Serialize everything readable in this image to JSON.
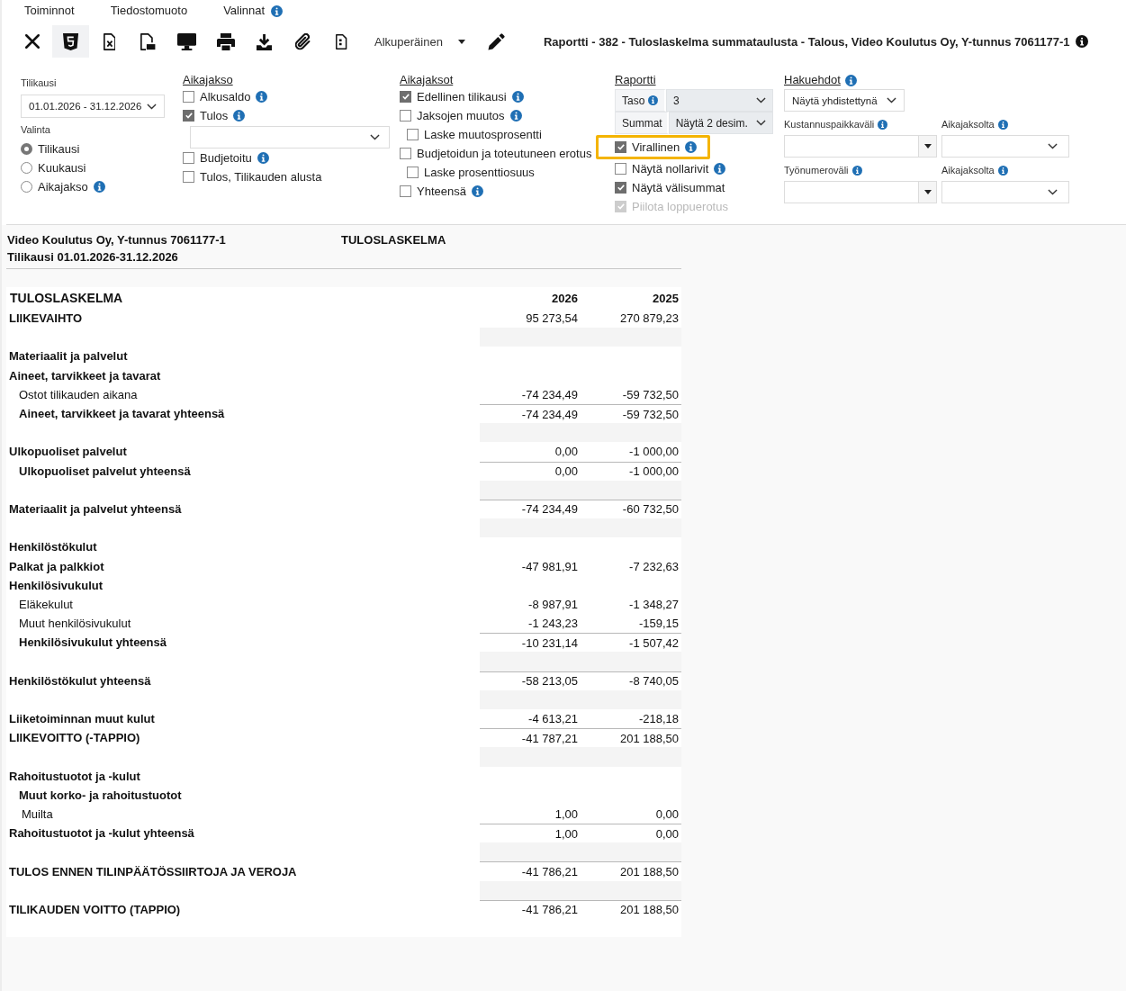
{
  "menu": [
    {
      "label": "Toiminnot",
      "info": false
    },
    {
      "label": "Tiedostomuoto",
      "info": false
    },
    {
      "label": "Valinnat",
      "info": true
    }
  ],
  "toolbar": [
    {
      "kind": "close",
      "selected": false
    },
    {
      "kind": "html",
      "selected": true
    },
    {
      "kind": "spreadsheet",
      "selected": false
    },
    {
      "kind": "pdf",
      "selected": false
    },
    {
      "kind": "screen",
      "selected": false
    },
    {
      "kind": "print",
      "selected": false
    },
    {
      "kind": "download",
      "selected": false
    },
    {
      "kind": "attach",
      "selected": false
    },
    {
      "kind": "document",
      "selected": false
    },
    {
      "kind": "dropdown",
      "value": "Alkuperäinen",
      "selected": false
    },
    {
      "kind": "edit",
      "selected": false
    }
  ],
  "title": {
    "text": "Raportti - 382 - Tuloslaskelma summataulusta - Talous, Video Koulutus Oy, Y-tunnus 7061177-1",
    "info": true
  },
  "filters": {
    "period": {
      "label": "Tilikausi",
      "value": "01.01.2026 - 31.12.2026"
    },
    "selection": {
      "label": "Valinta",
      "options": [
        {
          "label": "Tilikausi",
          "selected": true,
          "info": false
        },
        {
          "label": "Kuukausi",
          "selected": false,
          "info": false
        },
        {
          "label": "Aikajakso",
          "selected": false,
          "info": true
        }
      ]
    },
    "period_type": {
      "heading": "Aikajakso",
      "items": [
        {
          "kind": "checkbox",
          "label": "Alkusaldo",
          "checked": false,
          "info": true
        },
        {
          "kind": "checkbox",
          "label": "Tulos",
          "checked": true,
          "info": true
        },
        {
          "kind": "select"
        },
        {
          "kind": "checkbox",
          "label": "Budjetoitu",
          "checked": false,
          "info": true
        },
        {
          "kind": "checkbox",
          "label": "Tulos, Tilikauden alusta",
          "checked": false,
          "info": false
        }
      ]
    },
    "periods": {
      "heading": "Aikajaksot",
      "items": [
        {
          "label": "Edellinen tilikausi",
          "checked": true,
          "info": true
        },
        {
          "label": "Jaksojen muutos",
          "checked": false,
          "info": true,
          "children": [
            {
              "label": "Laske muutosprosentti",
              "checked": false,
              "info": false
            }
          ]
        },
        {
          "label": "Budjetoidun ja toteutuneen erotus",
          "checked": false,
          "info": false,
          "children": [
            {
              "label": "Laske prosenttiosuus",
              "checked": false,
              "info": false
            }
          ]
        },
        {
          "label": "Yhteensä",
          "checked": false,
          "info": true
        }
      ]
    },
    "report_options": {
      "heading": "Raportti",
      "selects": [
        {
          "label": "Taso",
          "info": true,
          "value": "3"
        },
        {
          "label": "Summat",
          "info": false,
          "value": "Näytä 2 desim."
        }
      ],
      "options": [
        {
          "label": "Virallinen",
          "checked": true,
          "info": true,
          "disabled": false,
          "highlighted": true
        },
        {
          "label": "Näytä nollarivit",
          "checked": false,
          "info": true,
          "disabled": false,
          "highlighted": false
        },
        {
          "label": "Näytä välisummat",
          "checked": true,
          "info": false,
          "disabled": false,
          "highlighted": false
        },
        {
          "label": "Piilota loppuerotus",
          "checked": true,
          "info": false,
          "disabled": true,
          "highlighted": false
        }
      ]
    },
    "search": {
      "heading": "Hakuehdot",
      "info": true,
      "mode": "Näytä yhdistettynä",
      "fields": [
        {
          "kind": "combo",
          "label": "Kustannuspaikkaväli",
          "info": true
        },
        {
          "kind": "select",
          "label": "Aikajaksolta",
          "info": true
        },
        {
          "kind": "combo",
          "label": "Työnumeroväli",
          "info": true
        },
        {
          "kind": "select",
          "label": "Aikajaksolta",
          "info": true
        }
      ]
    }
  },
  "report": {
    "header": {
      "company": "Video Koulutus Oy, Y-tunnus 7061177-1",
      "title": "TULOSLASKELMA",
      "period": "Tilikausi 01.01.2026-31.12.2026"
    },
    "table": {
      "title": "TULOSLASKELMA",
      "columns": [
        "2026",
        "2025"
      ],
      "rows": [
        {
          "kind": "row",
          "label": "LIIKEVAIHTO",
          "bold": true,
          "rule_above": false,
          "values": [
            "95 273,54",
            "270 879,23"
          ]
        },
        {
          "kind": "spacer"
        },
        {
          "kind": "row",
          "label": "Materiaalit ja palvelut",
          "bold": true,
          "rule_above": false
        },
        {
          "kind": "row",
          "label": "Aineet, tarvikkeet ja tavarat",
          "bold": true,
          "rule_above": false,
          "children": [
            {
              "kind": "row",
              "label": "Ostot tilikauden aikana",
              "bold": false,
              "rule_above": false,
              "values": [
                "-74 234,49",
                "-59 732,50"
              ]
            },
            {
              "kind": "row",
              "label": "Aineet, tarvikkeet ja tavarat yhteensä",
              "bold": true,
              "rule_above": true,
              "values": [
                "-74 234,49",
                "-59 732,50"
              ]
            }
          ]
        },
        {
          "kind": "spacer"
        },
        {
          "kind": "row",
          "label": "Ulkopuoliset palvelut",
          "bold": true,
          "rule_above": false,
          "values": [
            "0,00",
            "-1 000,00"
          ],
          "children": [
            {
              "kind": "row",
              "label": "Ulkopuoliset palvelut yhteensä",
              "bold": true,
              "rule_above": true,
              "values": [
                "0,00",
                "-1 000,00"
              ]
            }
          ]
        },
        {
          "kind": "spacer"
        },
        {
          "kind": "row",
          "label": "Materiaalit ja palvelut yhteensä",
          "bold": true,
          "rule_above": true,
          "values": [
            "-74 234,49",
            "-60 732,50"
          ]
        },
        {
          "kind": "spacer"
        },
        {
          "kind": "row",
          "label": "Henkilöstökulut",
          "bold": true,
          "rule_above": false
        },
        {
          "kind": "row",
          "label": "Palkat ja palkkiot",
          "bold": true,
          "rule_above": false,
          "values": [
            "-47 981,91",
            "-7 232,63"
          ]
        },
        {
          "kind": "row",
          "label": "Henkilösivukulut",
          "bold": true,
          "rule_above": false,
          "children": [
            {
              "kind": "row",
              "label": "Eläkekulut",
              "bold": false,
              "rule_above": false,
              "values": [
                "-8 987,91",
                "-1 348,27"
              ]
            },
            {
              "kind": "row",
              "label": "Muut henkilösivukulut",
              "bold": false,
              "rule_above": false,
              "values": [
                "-1 243,23",
                "-159,15"
              ]
            },
            {
              "kind": "row",
              "label": "Henkilösivukulut yhteensä",
              "bold": true,
              "rule_above": true,
              "values": [
                "-10 231,14",
                "-1 507,42"
              ]
            }
          ]
        },
        {
          "kind": "spacer"
        },
        {
          "kind": "row",
          "label": "Henkilöstökulut yhteensä",
          "bold": true,
          "rule_above": true,
          "values": [
            "-58 213,05",
            "-8 740,05"
          ]
        },
        {
          "kind": "spacer"
        },
        {
          "kind": "row",
          "label": "Liiketoiminnan muut kulut",
          "bold": true,
          "rule_above": false,
          "values": [
            "-4 613,21",
            "-218,18"
          ]
        },
        {
          "kind": "row",
          "label": "LIIKEVOITTO (-TAPPIO)",
          "bold": true,
          "rule_above": true,
          "values": [
            "-41 787,21",
            "201 188,50"
          ]
        },
        {
          "kind": "spacer"
        },
        {
          "kind": "row",
          "label": "Rahoitustuotot ja -kulut",
          "bold": true,
          "rule_above": false,
          "children": [
            {
              "kind": "row",
              "label": "Muut korko- ja rahoitustuotot",
              "bold": true,
              "rule_above": false,
              "children": [
                {
                  "kind": "row",
                  "label": "Muilta",
                  "bold": false,
                  "rule_above": false,
                  "values": [
                    "1,00",
                    "0,00"
                  ]
                }
              ]
            }
          ]
        },
        {
          "kind": "row",
          "label": "Rahoitustuotot ja -kulut yhteensä",
          "bold": true,
          "rule_above": true,
          "values": [
            "1,00",
            "0,00"
          ]
        },
        {
          "kind": "spacer"
        },
        {
          "kind": "row",
          "label": "TULOS ENNEN TILINPÄÄTÖSSIIRTOJA JA VEROJA",
          "bold": true,
          "rule_above": true,
          "values": [
            "-41 786,21",
            "201 188,50"
          ]
        },
        {
          "kind": "spacer"
        },
        {
          "kind": "row",
          "label": "TILIKAUDEN VOITTO (TAPPIO)",
          "bold": true,
          "rule_above": true,
          "values": [
            "-41 786,21",
            "201 188,50"
          ]
        }
      ]
    }
  }
}
